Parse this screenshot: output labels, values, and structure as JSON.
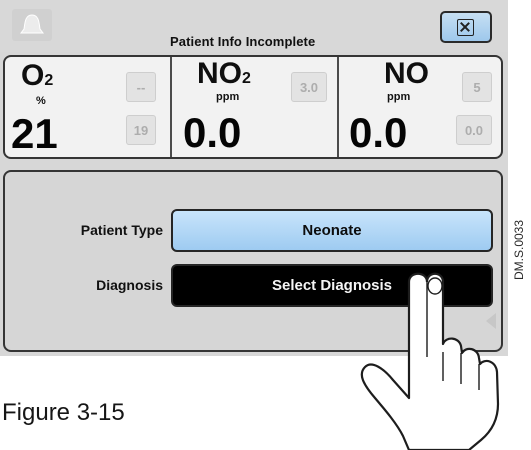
{
  "header": {
    "title": "Patient Info Incomplete",
    "alarm_icon": "alarm-bell-icon",
    "close_icon": "close-box-icon"
  },
  "gases": [
    {
      "name": "O",
      "subscript": "2",
      "unit": "%",
      "value": "21",
      "upper_limit": "--",
      "lower_limit": "19"
    },
    {
      "name": "NO",
      "subscript": "2",
      "unit": "ppm",
      "value": "0.0",
      "upper_limit": "3.0"
    },
    {
      "name": "NO",
      "unit": "ppm",
      "value": "0.0",
      "upper_limit": "5",
      "lower_limit": "0.0"
    }
  ],
  "patient": {
    "type_label": "Patient Type",
    "type_value": "Neonate",
    "diagnosis_label": "Diagnosis",
    "diagnosis_value": "Select Diagnosis"
  },
  "figure": {
    "caption": "Figure 3-15",
    "code": "DM.S.0033"
  },
  "colors": {
    "screen_bg": "#d7d7d7",
    "blue_button": "#aed4f4",
    "black_button": "#000000"
  }
}
